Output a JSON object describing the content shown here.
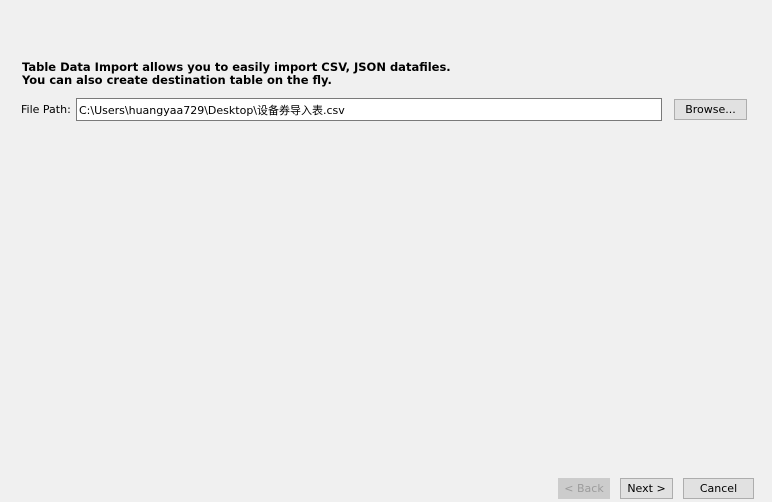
{
  "intro": {
    "line1": "Table Data Import allows you to easily import CSV, JSON datafiles.",
    "line2": "You can also create destination table on the fly."
  },
  "file_path": {
    "label": "File Path:",
    "value": "C:\\Users\\huangyaa729\\Desktop\\设备券导入表.csv",
    "browse_label": "Browse..."
  },
  "footer": {
    "back_label": "< Back",
    "next_label": "Next >",
    "cancel_label": "Cancel"
  }
}
